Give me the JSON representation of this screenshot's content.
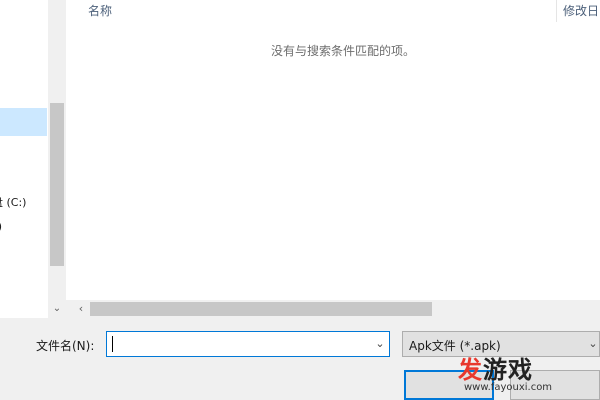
{
  "nav": {
    "items": [
      {
        "label": "盘 (C:)"
      },
      {
        "label": ":)"
      },
      {
        "label": ")"
      },
      {
        "label": ")"
      }
    ]
  },
  "file_list": {
    "columns": [
      "名称",
      "修改日"
    ],
    "empty_message": "没有与搜索条件匹配的项。"
  },
  "bottom_bar": {
    "filename_label": "文件名(N):",
    "filename_value": "",
    "filetype_selected": "Apk文件 (*.apk)"
  },
  "watermark": {
    "brand": "发游戏",
    "url": "www.fayouxi.com"
  },
  "colors": {
    "accent": "#0078d7",
    "selection": "#cce8ff",
    "watermark_accent": "#e8382d"
  }
}
